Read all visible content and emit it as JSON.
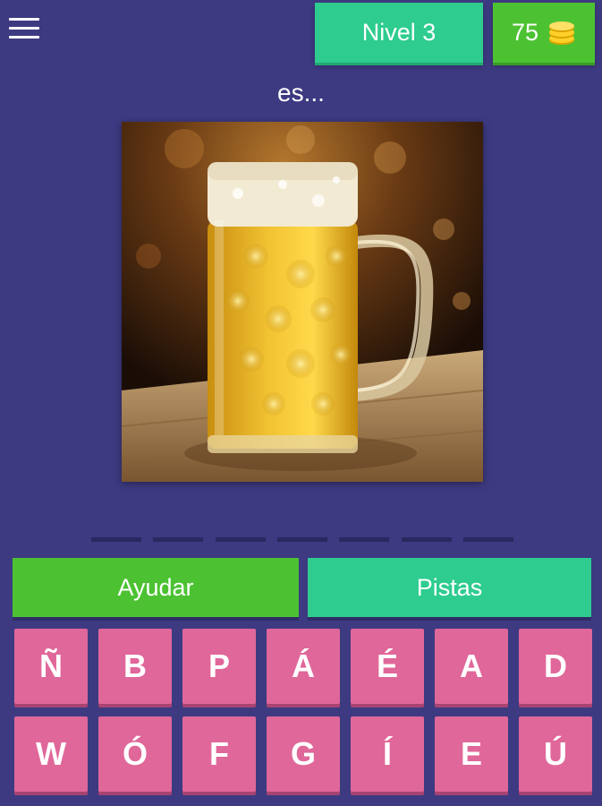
{
  "header": {
    "menu_icon": "hamburger-menu-icon",
    "level_label": "Nivel 3",
    "coins": "75",
    "coin_icon": "coin-stack-icon"
  },
  "prompt": "es...",
  "image": {
    "subject": "beer-mug-image"
  },
  "answer": {
    "slot_count": 7
  },
  "actions": {
    "help_label": "Ayudar",
    "hints_label": "Pistas"
  },
  "keyboard": {
    "row1": [
      "Ñ",
      "B",
      "P",
      "Á",
      "É",
      "A",
      "D"
    ],
    "row2": [
      "W",
      "Ó",
      "F",
      "G",
      "Í",
      "E",
      "Ú"
    ]
  },
  "colors": {
    "background": "#3d3a82",
    "level_badge": "#2ecc8f",
    "coins_badge": "#4cc232",
    "help_button": "#4cc232",
    "hints_button": "#2ecc8f",
    "key": "#e0679a",
    "slot": "#2a285f"
  }
}
